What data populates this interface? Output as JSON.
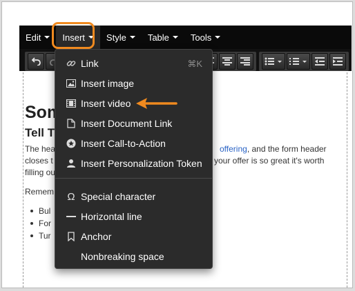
{
  "menubar": {
    "items": [
      {
        "label": "Edit"
      },
      {
        "label": "Insert"
      },
      {
        "label": "Style"
      },
      {
        "label": "Table"
      },
      {
        "label": "Tools"
      }
    ]
  },
  "document": {
    "heading": "Som",
    "subheading": "Tell T",
    "paragraph_line1_left": "The hea",
    "paragraph_line1_link": "offering",
    "paragraph_line1_right": ", and the form header",
    "paragraph_line2_left": "closes t",
    "paragraph_line2_right": " your offer is so great it's worth",
    "paragraph_line3": "filling ou",
    "paragraph2": "Remem",
    "bullets": [
      "Bul",
      "For",
      "Tur"
    ]
  },
  "dropdown": {
    "items": [
      {
        "label": "Link",
        "shortcut": "⌘K",
        "icon": "link-icon"
      },
      {
        "label": "Insert image",
        "icon": "image-icon"
      },
      {
        "label": "Insert video",
        "icon": "film-icon"
      },
      {
        "label": "Insert Document Link",
        "icon": "document-icon"
      },
      {
        "label": "Insert Call-to-Action",
        "icon": "star-badge-icon"
      },
      {
        "label": "Insert Personalization Token",
        "icon": "person-icon"
      },
      {
        "label": "Special character",
        "icon": "omega-icon"
      },
      {
        "label": "Horizontal line",
        "icon": "horizontal-line-icon"
      },
      {
        "label": "Anchor",
        "icon": "bookmark-icon"
      },
      {
        "label": "Nonbreaking space",
        "icon": ""
      }
    ]
  },
  "colors": {
    "accent": "#f08a1f",
    "menubar_bg": "#0a0a0a",
    "dropdown_bg": "#2b2b2b",
    "link": "#2a63c5"
  }
}
